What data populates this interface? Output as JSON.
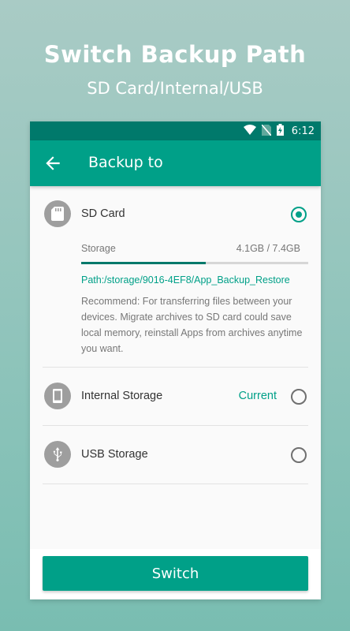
{
  "promo": {
    "title": "Switch Backup Path",
    "subtitle": "SD Card/Internal/USB"
  },
  "statusbar": {
    "time": "6:12",
    "icons": [
      "wifi-icon",
      "no-sim-icon",
      "battery-charging-icon"
    ]
  },
  "appbar": {
    "back_icon": "arrow-back-icon",
    "title": "Backup to"
  },
  "options": {
    "sd_card": {
      "icon": "sd-card-icon",
      "label": "SD Card",
      "selected": true,
      "storage_label": "Storage",
      "storage_value": "4.1GB / 7.4GB",
      "used_fraction": 0.55,
      "path": "Path:/storage/9016-4EF8/App_Backup_Restore",
      "recommend": "Recommend: For transferring files between your devices. Migrate archives to SD card could save local memory, reinstall Apps from archives anytime you want."
    },
    "internal": {
      "icon": "phone-icon",
      "label": "Internal Storage",
      "badge": "Current",
      "selected": false
    },
    "usb": {
      "icon": "usb-icon",
      "label": "USB Storage",
      "selected": false
    }
  },
  "actions": {
    "switch_label": "Switch"
  },
  "colors": {
    "accent": "#00a088",
    "statusbar": "#00796b",
    "icon_circle": "#9e9e9e"
  }
}
